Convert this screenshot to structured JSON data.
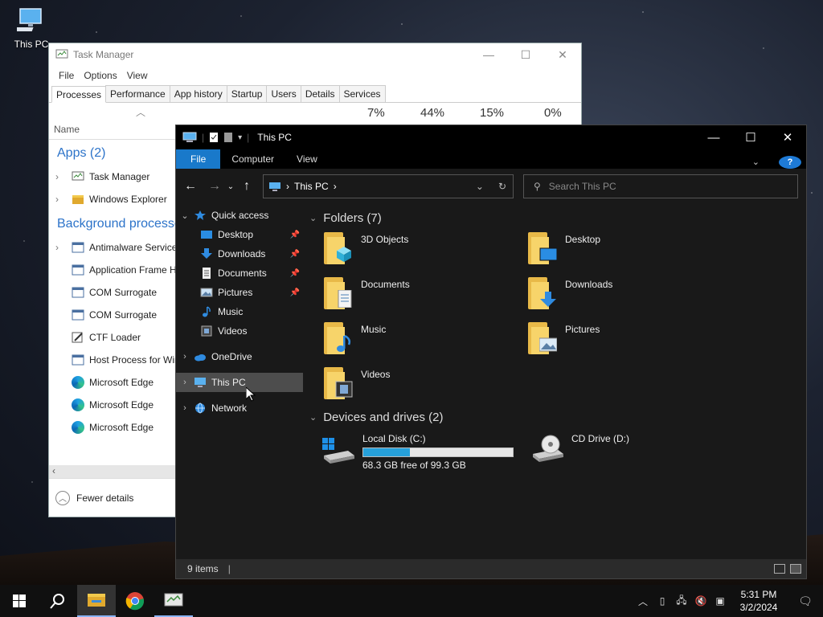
{
  "desktop": {
    "icon_label": "This PC"
  },
  "task_manager": {
    "title": "Task Manager",
    "menu": [
      "File",
      "Options",
      "View"
    ],
    "tabs": [
      "Processes",
      "Performance",
      "App history",
      "Startup",
      "Users",
      "Details",
      "Services"
    ],
    "columns": {
      "name": "Name",
      "cpu": "7%",
      "memory": "44%",
      "disk": "15%",
      "network": "0%"
    },
    "apps_heading": "Apps (2)",
    "apps": [
      "Task Manager",
      "Windows Explorer"
    ],
    "bg_heading": "Background processes",
    "bg_processes": [
      "Antimalware Service",
      "Application Frame H",
      "COM Surrogate",
      "COM Surrogate",
      "CTF Loader",
      "Host Process for Win",
      "Microsoft Edge",
      "Microsoft Edge",
      "Microsoft Edge"
    ],
    "fewer_details": "Fewer details"
  },
  "explorer": {
    "title": "This PC",
    "ribbon": {
      "file": "File",
      "computer": "Computer",
      "view": "View",
      "help": "?"
    },
    "address": "This PC",
    "search_placeholder": "Search This PC",
    "nav": {
      "quick_access": "Quick access",
      "quick_items": [
        "Desktop",
        "Downloads",
        "Documents",
        "Pictures",
        "Music",
        "Videos"
      ],
      "onedrive": "OneDrive",
      "this_pc": "This PC",
      "network": "Network"
    },
    "folders_heading": "Folders (7)",
    "folders": [
      "3D Objects",
      "Desktop",
      "Documents",
      "Downloads",
      "Music",
      "Pictures",
      "Videos"
    ],
    "devices_heading": "Devices and drives (2)",
    "drives": {
      "local": {
        "name": "Local Disk (C:)",
        "free": "68.3 GB free of 99.3 GB",
        "used_fraction": 0.312
      },
      "cd": {
        "name": "CD Drive (D:)"
      }
    },
    "status": "9 items"
  },
  "taskbar": {
    "time": "5:31 PM",
    "date": "3/2/2024"
  },
  "colors": {
    "accent": "#1979ca",
    "drive_bar": "#26a0da",
    "link_blue": "#2c73c9"
  }
}
